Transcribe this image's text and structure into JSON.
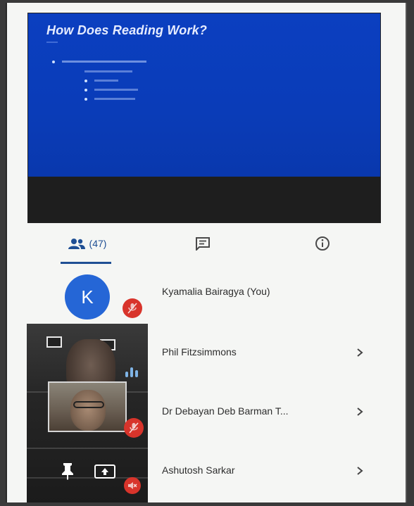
{
  "slide": {
    "title": "How Does Reading Work?",
    "bullets": [
      "",
      "",
      "",
      "",
      ""
    ]
  },
  "tabs": {
    "people_count": "(47)",
    "active": "people"
  },
  "participants": [
    {
      "name": "Kyamalia Bairagya (You)",
      "avatar_letter": "K",
      "muted": true
    },
    {
      "name": "Phil Fitzsimmons",
      "muted": false
    },
    {
      "name": "Dr Debayan Deb Barman T...",
      "muted": true
    },
    {
      "name": "Ashutosh Sarkar",
      "muted": true
    }
  ],
  "icons": {
    "people": "people-icon",
    "chat": "chat-icon",
    "info": "info-icon",
    "chevron": "chevron-right-icon",
    "mic_off": "mic-off-icon",
    "pin": "pin-icon",
    "present": "present-screen-icon",
    "audio": "audio-level-icon"
  },
  "colors": {
    "accent": "#1f4f94",
    "avatar": "#2566d6",
    "muted_badge": "#d8342b",
    "slide_bg": "#0b3fc0"
  }
}
